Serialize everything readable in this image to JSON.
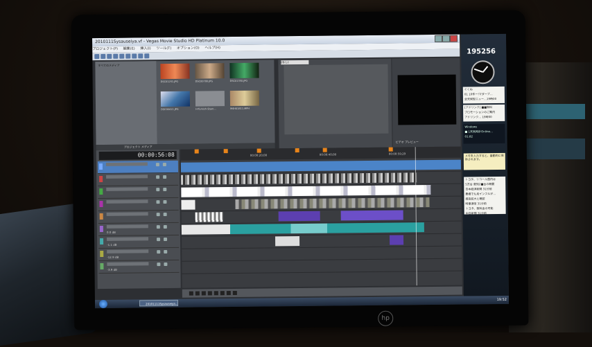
{
  "window": {
    "title": "2010111Sysauseiya.vf - Vegas Movie Studio HD Platinum 10.0"
  },
  "menu": [
    "プロジェクト(P)",
    "編集(E)",
    "挿入(I)",
    "ツール(T)",
    "オプション(O)",
    "ヘルプ(H)"
  ],
  "media_panel": {
    "tree_root": "すべてのメディア",
    "tab_label": "プロジェクト メディア",
    "files": [
      "DSC01251.JPG",
      "DSC00780.JPG",
      "DSC01350.JPG",
      "DSC00411.JPG",
      "H-Turkish-Stam...",
      "M4H01811.MPH"
    ]
  },
  "trimmer": {
    "dropdown": "(なし)"
  },
  "preview": {
    "label": "ビデオ プレビュー"
  },
  "timeline": {
    "timecode": "00:00:56:08",
    "ruler_labels": [
      "00:00:20;00",
      "00:00:40;00",
      "00:00:59;29",
      "00:01:20;00"
    ],
    "track_levels": [
      "0.0 dB",
      "-1.1 dB",
      "-12.9 dB",
      "-3.9 dB"
    ]
  },
  "taskbar": {
    "task": "20101111Sysauseiya...",
    "clock": "19:52"
  },
  "gadgets": {
    "counter": "195256",
    "news_1": [
      "ぐくね",
      "01 10件ー!マダーブ…",
      "全天候型ニュー…19時00"
    ],
    "news_2": [
      "[アドリンク] ■■無料",
      "プロモーションのご案内",
      "アドリンク… 19時00"
    ],
    "weather": [
      "Windows",
      "■ 1天気時計Online…",
      "01:82"
    ],
    "notice": [
      "メモを入力すると、自動的に保存されます。"
    ],
    "headlines": [
      "トヨタ、リコール国内は",
      "5万台 愛知2■台の概要",
      "日本経済新聞  31分前",
      "豊橋でも鳥インフルが…",
      "感染拡大と確認",
      "時事通信  31分前",
      "トヨタ、数料金の可能",
      "中日新聞  31分前"
    ]
  }
}
